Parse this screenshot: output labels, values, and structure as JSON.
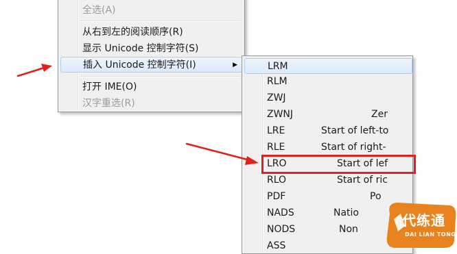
{
  "main_menu": {
    "items": [
      {
        "label": "全选(A)",
        "disabled": true
      },
      {
        "label": "从右到左的阅读顺序(R)",
        "disabled": false
      },
      {
        "label": "显示 Unicode 控制字符(S)",
        "disabled": false
      },
      {
        "label": "插入 Unicode 控制字符(I)",
        "disabled": false,
        "has_submenu": true,
        "highlighted": true
      },
      {
        "label": "打开 IME(O)",
        "disabled": false
      },
      {
        "label": "汉字重选(R)",
        "disabled": true
      }
    ],
    "submenu_arrow": "▶"
  },
  "sub_menu": {
    "items": [
      {
        "code": "LRM",
        "desc": "",
        "highlighted": true
      },
      {
        "code": "RLM",
        "desc": ""
      },
      {
        "code": "ZWJ",
        "desc": ""
      },
      {
        "code": "ZWNJ",
        "desc": "Zer"
      },
      {
        "code": "LRE",
        "desc": "Start of left-to"
      },
      {
        "code": "RLE",
        "desc": "Start of right-"
      },
      {
        "code": "LRO",
        "desc": "Start of lef"
      },
      {
        "code": "RLO",
        "desc": "Start of ric"
      },
      {
        "code": "PDF",
        "desc": "Po"
      },
      {
        "code": "NADS",
        "desc": "Natio"
      },
      {
        "code": "NODS",
        "desc": "Non"
      },
      {
        "code": "ASS",
        "desc": ""
      }
    ]
  },
  "watermark": {
    "text": "代练通",
    "sub": "DAI LIAN TONG"
  },
  "colors": {
    "annotation_red": "#e0201a",
    "menu_bg": "#f0f0f0",
    "watermark_orange": "#e8821e"
  }
}
